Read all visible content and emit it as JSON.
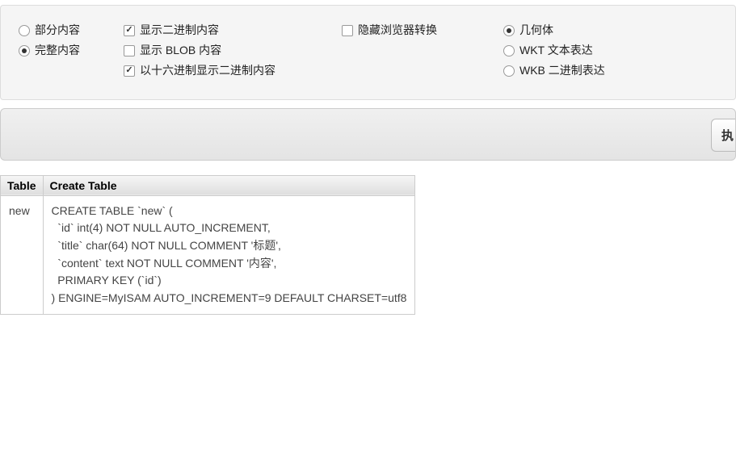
{
  "options": {
    "col1": {
      "partial_content": {
        "label": "部分内容",
        "checked": false
      },
      "full_content": {
        "label": "完整内容",
        "checked": true
      }
    },
    "col2": {
      "show_binary": {
        "label": "显示二进制内容",
        "checked": true
      },
      "show_blob": {
        "label": "显示 BLOB 内容",
        "checked": false
      },
      "show_hex_binary": {
        "label": "以十六进制显示二进制内容",
        "checked": true
      }
    },
    "col3": {
      "hide_browser_transform": {
        "label": "隐藏浏览器转换",
        "checked": false
      }
    },
    "col4": {
      "geometry": {
        "label": "几何体",
        "checked": true
      },
      "wkt": {
        "label": "WKT 文本表达",
        "checked": false
      },
      "wkb": {
        "label": "WKB 二进制表达",
        "checked": false
      }
    }
  },
  "button_bar": {
    "execute_label": "执"
  },
  "results": {
    "headers": {
      "table": "Table",
      "create_table": "Create Table"
    },
    "row": {
      "table_name": "new",
      "create_sql": "CREATE TABLE `new` (\n  `id` int(4) NOT NULL AUTO_INCREMENT,\n  `title` char(64) NOT NULL COMMENT '标题',\n  `content` text NOT NULL COMMENT '内容',\n  PRIMARY KEY (`id`)\n) ENGINE=MyISAM AUTO_INCREMENT=9 DEFAULT CHARSET=utf8"
    }
  }
}
